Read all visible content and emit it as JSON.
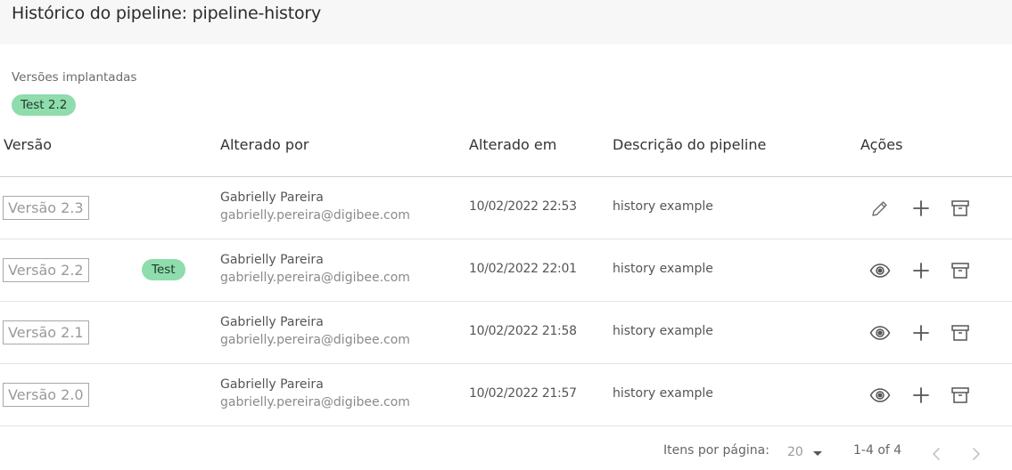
{
  "header": {
    "title": "Histórico do pipeline: pipeline-history"
  },
  "deployed": {
    "label": "Versões implantadas",
    "chips": [
      "Test 2.2"
    ]
  },
  "table": {
    "columns": [
      "Versão",
      "Alterado por",
      "Alterado em",
      "Descrição do pipeline",
      "Ações"
    ],
    "rows": [
      {
        "version": "Versão 2.3",
        "env": "",
        "name": "Gabrielly Pareira",
        "email": "gabrielly.pereira@digibee.com",
        "date": "10/02/2022 22:53",
        "description": "history example",
        "first_action_icon": "pencil-icon"
      },
      {
        "version": "Versão 2.2",
        "env": "Test",
        "name": "Gabrielly Pareira",
        "email": "gabrielly.pereira@digibee.com",
        "date": "10/02/2022 22:01",
        "description": "history example",
        "first_action_icon": "eye-icon"
      },
      {
        "version": "Versão 2.1",
        "env": "",
        "name": "Gabrielly Pareira",
        "email": "gabrielly.pereira@digibee.com",
        "date": "10/02/2022 21:58",
        "description": "history example",
        "first_action_icon": "eye-icon"
      },
      {
        "version": "Versão 2.0",
        "env": "",
        "name": "Gabrielly Pareira",
        "email": "gabrielly.pereira@digibee.com",
        "date": "10/02/2022 21:57",
        "description": "history example",
        "first_action_icon": "eye-icon"
      }
    ]
  },
  "pagination": {
    "items_per_page_label": "Itens por página:",
    "items_per_page": "20",
    "range": "1-4 of 4"
  },
  "colors": {
    "chip": "#8fdcad",
    "header_bg": "#f7f7f7",
    "icon": "#6b6b6b"
  }
}
